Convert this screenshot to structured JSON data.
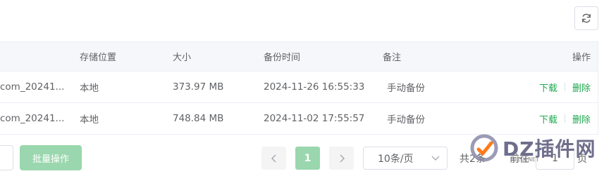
{
  "header": {
    "refresh_icon": "refresh-icon"
  },
  "table": {
    "columns": {
      "name": "",
      "location": "存储位置",
      "size": "大小",
      "time": "备份时间",
      "note": "备注",
      "ops": "操作"
    },
    "rows": [
      {
        "name": "com_20241...",
        "location": "本地",
        "size": "373.97 MB",
        "time": "2024-11-26 16:55:33",
        "note": "手动备份",
        "download": "下载",
        "delete": "删除"
      },
      {
        "name": "com_20241...",
        "location": "本地",
        "size": "748.84 MB",
        "time": "2024-11-02 17:55:57",
        "note": "手动备份",
        "download": "下载",
        "delete": "删除"
      }
    ]
  },
  "footer": {
    "batch_label": "批量操作",
    "prev_icon": "chevron-left-icon",
    "next_icon": "chevron-right-icon",
    "current_page": "1",
    "page_size": "10条/页",
    "total": "共2条",
    "goto_prefix": "前往",
    "goto_value": "1",
    "goto_suffix": "页"
  },
  "watermark": {
    "text": "DZ插件网",
    "sub": "DZ-X.NET"
  },
  "colors": {
    "accent": "#1ea84e",
    "accent_light": "#9ad7ae",
    "header_bg": "#f5f7fa",
    "border": "#ebeef5"
  }
}
